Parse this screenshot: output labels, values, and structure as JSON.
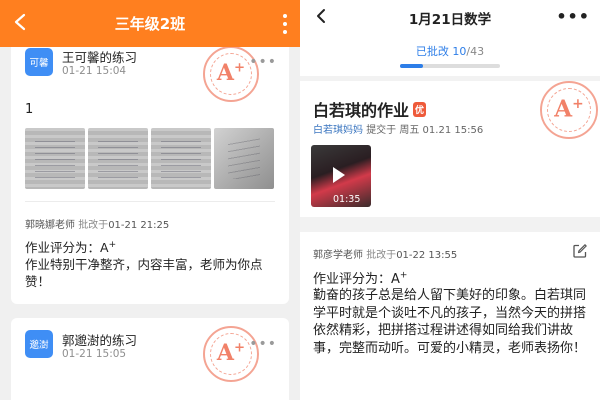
{
  "left": {
    "header": {
      "title": "三年级2班",
      "bg_color": "#ff7f1f"
    },
    "card1": {
      "avatar_text": "可馨",
      "student_name": "王可馨的练习",
      "submitted_time": "01-21 15:04",
      "stamp_grade": "A",
      "stamp_plus": "+",
      "content_text": "1",
      "teacher": "郭晓娜老师",
      "graded_label": "批改于",
      "graded_time": "01-21 21:25",
      "grade_line": "作业评分为：A",
      "grade_plus": "+",
      "comment": "作业特别干净整齐，内容丰富，老师为你点赞！"
    },
    "card2": {
      "avatar_text": "邈澍",
      "student_name": "郭邈澍的练习",
      "submitted_time": "01-21 15:05",
      "stamp_grade": "A",
      "stamp_plus": "+"
    }
  },
  "right": {
    "header": {
      "title": "1月21日数学"
    },
    "status": {
      "label": "已批改",
      "done": "10",
      "slash": "/",
      "total": "43",
      "progress_fraction": 0.233
    },
    "submission": {
      "title": "白若琪的作业",
      "badge": "优",
      "parent": "白若琪妈妈",
      "submit_label": "提交于",
      "submit_time": "周五 01.21 15:56",
      "video_duration": "01:35",
      "stamp_grade": "A",
      "stamp_plus": "+"
    },
    "review": {
      "teacher": "郭彦学老师",
      "graded_label": "批改于",
      "graded_time": "01-22 13:55",
      "grade_line": "作业评分为：A",
      "grade_plus": "+",
      "comment": "勤奋的孩子总是给人留下美好的印象。白若琪同学平时就是个谈吐不凡的孩子，当然今天的拼搭依然精彩，把拼搭过程讲述得如同给我们讲故事，完整而动听。可爱的小精灵，老师表扬你！"
    }
  }
}
